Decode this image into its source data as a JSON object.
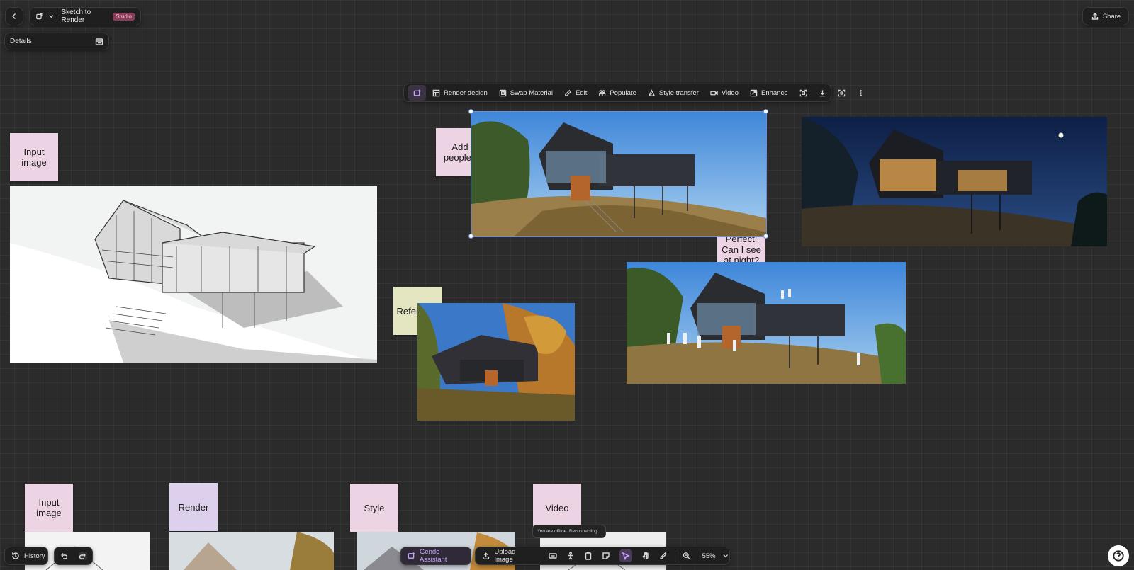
{
  "header": {
    "back_icon": "chevron-left-icon",
    "app_icon": "pen-square-icon",
    "project_title": "Sketch to Render",
    "plan_badge": "Studio",
    "share_label": "Share"
  },
  "details_panel": {
    "label": "Details"
  },
  "image_toolbar": {
    "items": [
      {
        "label": "Render design",
        "icon": "render-icon"
      },
      {
        "label": "Swap Material",
        "icon": "material-icon"
      },
      {
        "label": "Edit",
        "icon": "edit-icon"
      },
      {
        "label": "Populate",
        "icon": "people-icon"
      },
      {
        "label": "Style transfer",
        "icon": "style-icon"
      },
      {
        "label": "Video",
        "icon": "video-icon"
      },
      {
        "label": "Enhance",
        "icon": "enhance-icon"
      }
    ]
  },
  "canvas": {
    "notes": {
      "input_image": "Input image",
      "add_people": "Add people?",
      "perfect_night": "Perfect! Can I see at night?",
      "reference": "Reference",
      "input_image_2": "Input image",
      "render": "Render",
      "style": "Style",
      "video": "Video"
    }
  },
  "bottom_bar": {
    "history_label": "History",
    "assistant_label": "Gendo Assistant",
    "upload_label": "Upload Image",
    "zoom_label": "55%",
    "offline_toast": "You are offline. Reconnecting..."
  },
  "colors": {
    "canvas_bg": "#2b2b2b",
    "accent_purple": "#c9a6ff",
    "sticky_pink": "#ecd4e4",
    "sticky_lavender": "#dcd0ec",
    "sticky_lime": "#e3e6c1",
    "selection_blue": "#6a8fd8"
  }
}
